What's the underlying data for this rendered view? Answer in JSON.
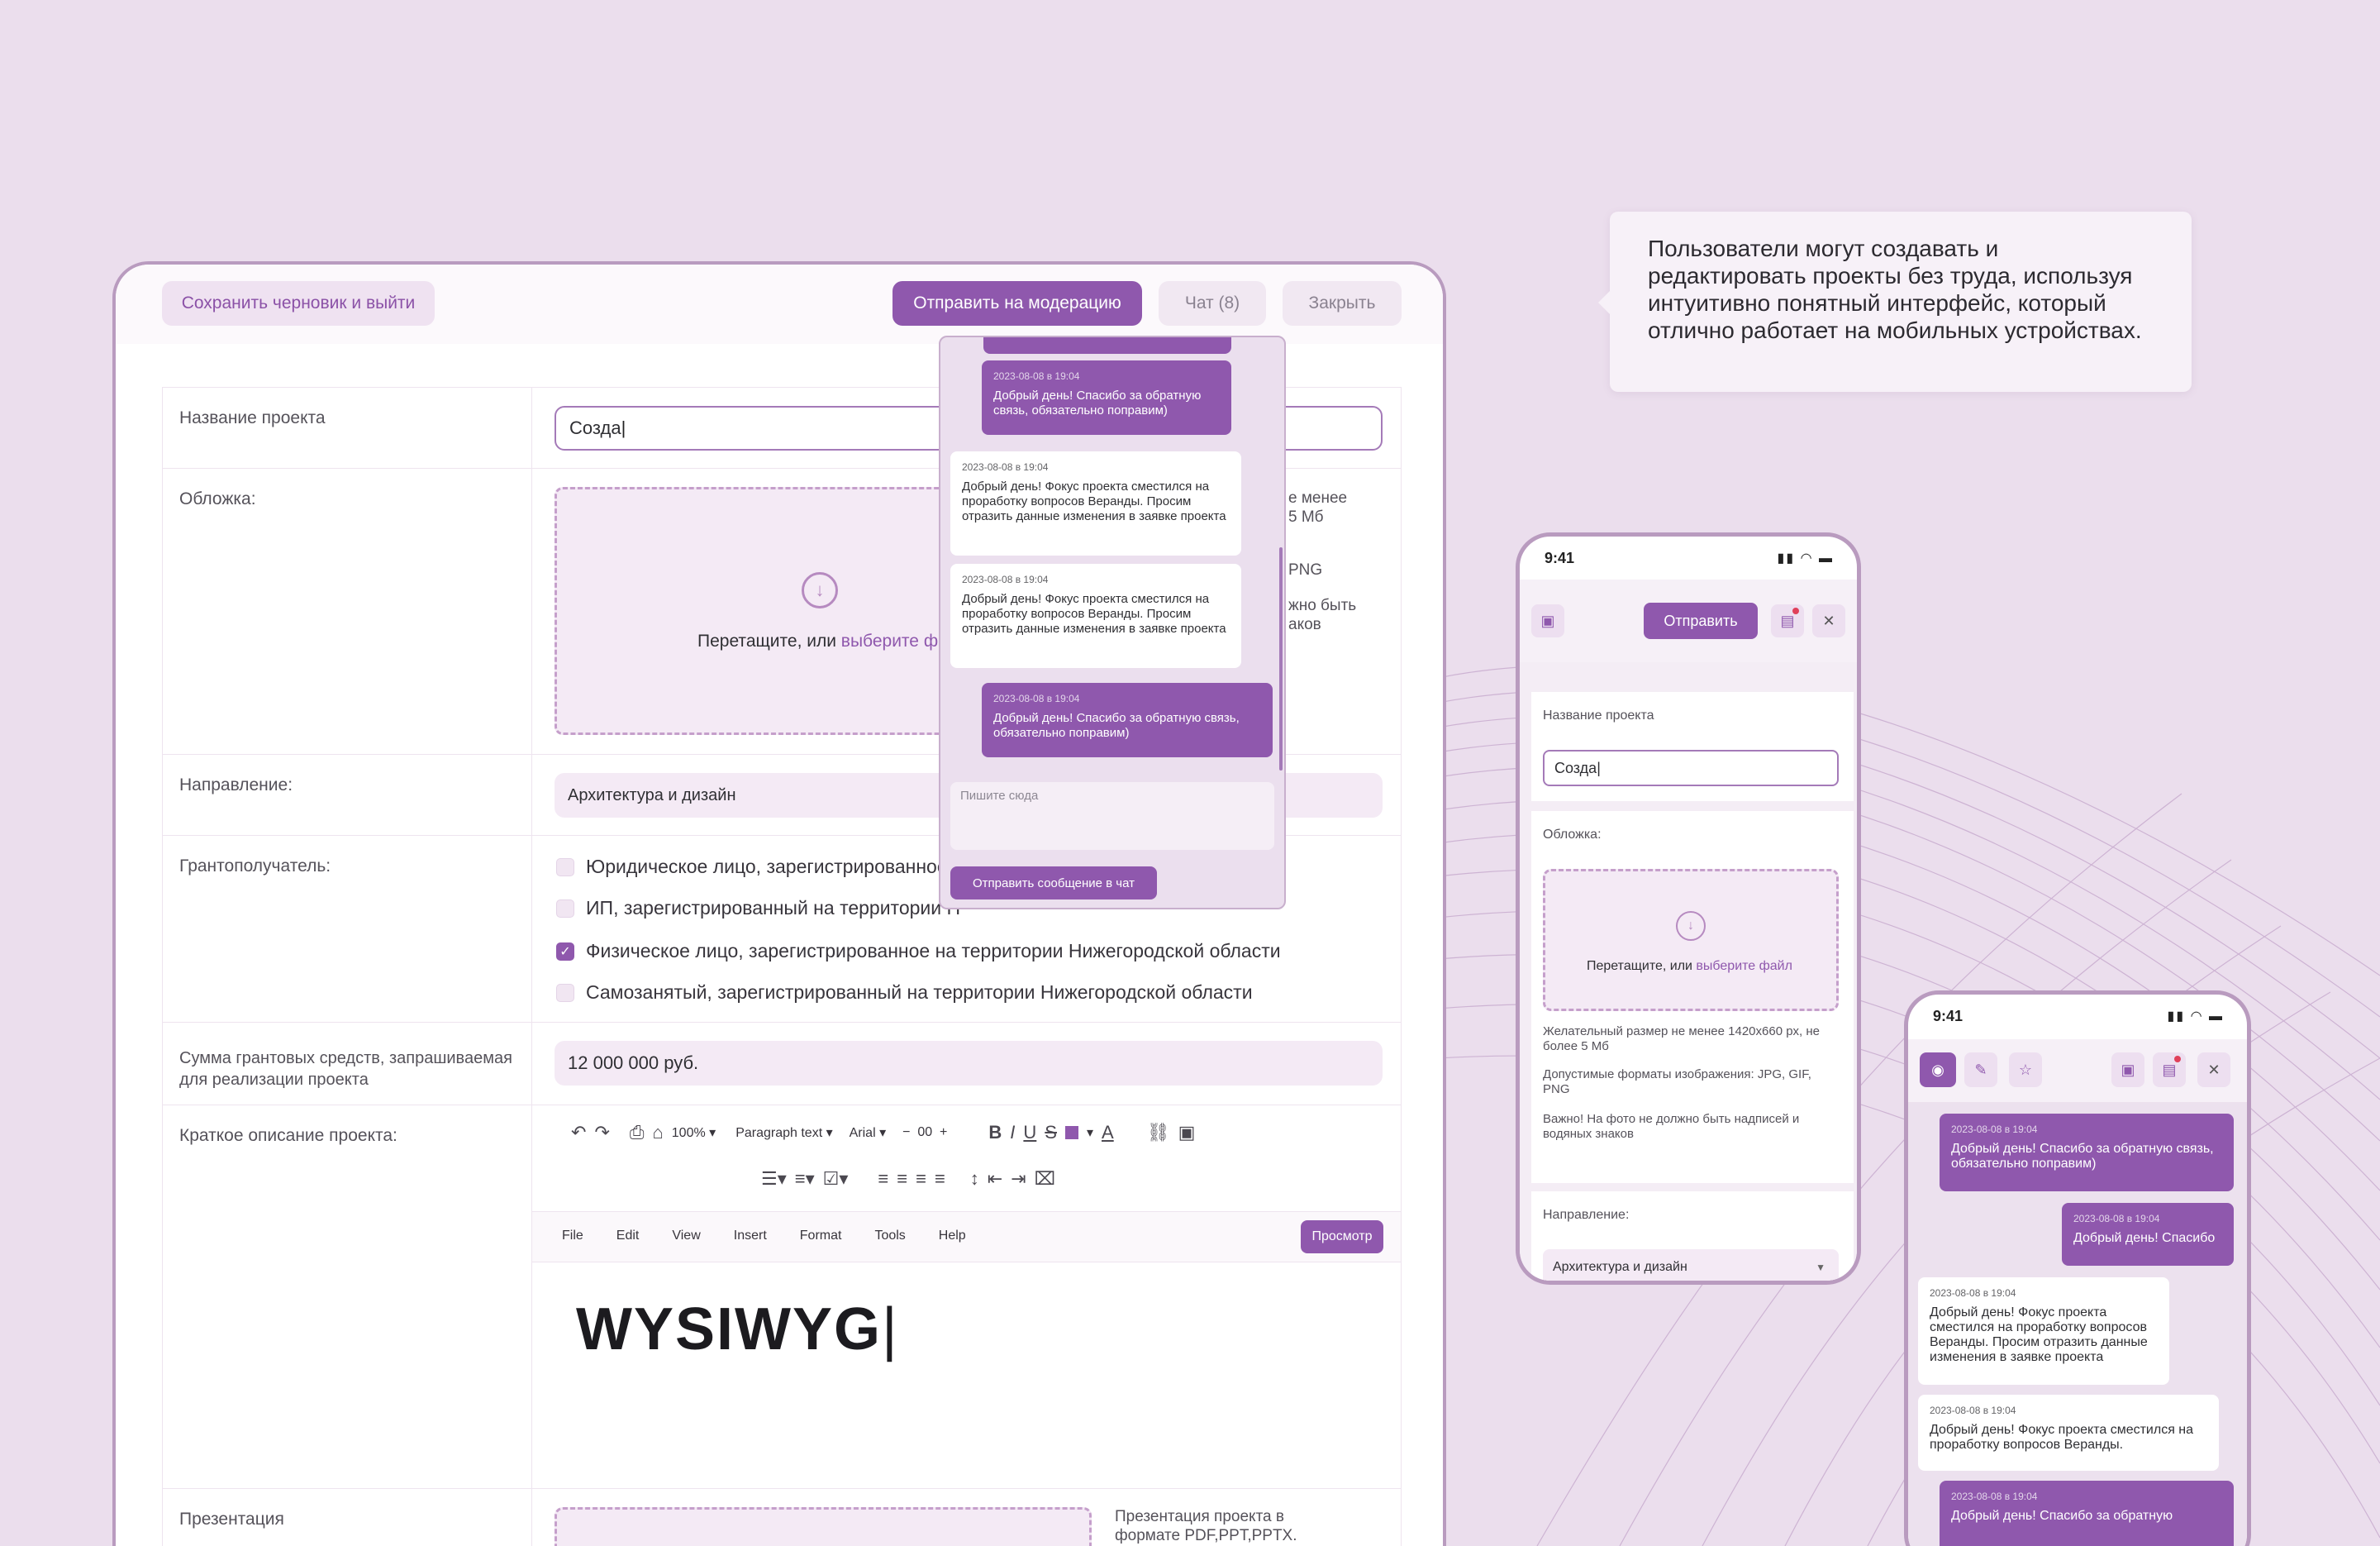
{
  "tooltip": {
    "text": "Пользователи могут создавать и редактировать проекты без труда, используя интуитивно понятный интерфейс, который отлично работает на мобильных устройствах."
  },
  "desktop": {
    "header": {
      "save_draft": "Сохранить черновик и выйти",
      "send_moderation": "Отправить на модерацию",
      "chat": "Чат (8)",
      "close": "Закрыть"
    },
    "form": {
      "name_label": "Название проекта",
      "name_value": "Созда",
      "cover_label": "Обложка:",
      "drop_text": "Перетащите, или ",
      "drop_link": "выберите файл",
      "cover_hint1": "е менее",
      "cover_hint1b": "5 Мб",
      "cover_hint2": "PNG",
      "cover_hint3": "жно быть",
      "cover_hint3b": "аков",
      "direction_label": "Направление:",
      "direction_value": "Архитектура и дизайн",
      "grantee_label": "Грантополучатель:",
      "grantee_options": [
        {
          "label": "Юридическое лицо, зарегистрированное н",
          "checked": false
        },
        {
          "label": "ИП, зарегистрированный на территории Н",
          "checked": false
        },
        {
          "label": "Физическое лицо, зарегистрированное на территории Нижегородской области",
          "checked": true
        },
        {
          "label": "Самозанятый, зарегистрированный на территории Нижегородской области",
          "checked": false
        }
      ],
      "sum_label": "Сумма грантовых средств, запрашиваемая для реализации проекта",
      "sum_value": "12 000 000 руб.",
      "desc_label": "Краткое описание проекта:",
      "editor": {
        "zoom": "100%",
        "style": "Paragraph text",
        "font": "Arial",
        "size": "00",
        "menu": [
          "File",
          "Edit",
          "View",
          "Insert",
          "Format",
          "Tools",
          "Help"
        ],
        "preview": "Просмотр",
        "content": "WYSIWYG"
      },
      "presentation_label": "Презентация",
      "presentation_hint": "Презентация проекта в формате PDF,PPT,PPTX."
    },
    "chat": {
      "messages": [
        {
          "time": "2023-08-08 в 19:04",
          "text": "Добрый день! Спасибо за обратную связь, обязательно поправим)",
          "out": true
        },
        {
          "time": "2023-08-08 в 19:04",
          "text": "Добрый день! Фокус проекта сместился на проработку вопросов Веранды. Просим отразить данные изменения в заявке проекта",
          "out": false
        },
        {
          "time": "2023-08-08 в 19:04",
          "text": "Добрый день! Фокус проекта сместился на проработку вопросов Веранды. Просим отразить данные изменения в заявке проекта",
          "out": false
        },
        {
          "time": "2023-08-08 в 19:04",
          "text": "Добрый день! Спасибо за обратную связь, обязательно поправим)",
          "out": true
        }
      ],
      "placeholder": "Пишите сюда",
      "send": "Отправить сообщение в чат"
    }
  },
  "phone1": {
    "time": "9:41",
    "send": "Отправить",
    "name_label": "Название проекта",
    "name_value": "Созда",
    "cover_label": "Обложка:",
    "drop_text": "Перетащите, или ",
    "drop_link": "выберите файл",
    "hint1": "Желательный размер не менее 1420x660 px, не более 5 Мб",
    "hint2": "Допустимые форматы изображения: JPG, GIF, PNG",
    "hint3": "Важно! На фото не должно быть надписей и водяных знаков",
    "direction_label": "Направление:",
    "direction_value": "Архитектура и дизайн"
  },
  "phone2": {
    "time": "9:41",
    "messages": [
      {
        "time": "2023-08-08 в 19:04",
        "text": "Добрый день! Спасибо за обратную связь, обязательно поправим)",
        "out": true
      },
      {
        "time": "2023-08-08 в 19:04",
        "text": "Добрый день! Спасибо",
        "out": true
      },
      {
        "time": "2023-08-08 в 19:04",
        "text": "Добрый день! Фокус проекта сместился на проработку вопросов Веранды. Просим отразить данные изменения в заявке проекта",
        "out": false
      },
      {
        "time": "2023-08-08 в 19:04",
        "text": "Добрый день! Фокус проекта сместился на проработку вопросов Веранды.",
        "out": false
      },
      {
        "time": "2023-08-08 в 19:04",
        "text": "Добрый день! Спасибо за обратную",
        "out": true
      }
    ]
  },
  "colors": {
    "accent": "#8f58ad",
    "background": "#ebdeed",
    "soft": "#f4eaf5"
  }
}
